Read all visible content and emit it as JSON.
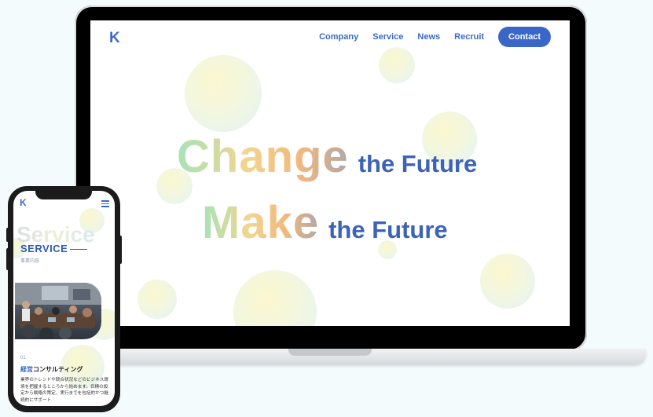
{
  "desktop": {
    "logo": "K",
    "nav": [
      "Company",
      "Service",
      "News",
      "Recruit"
    ],
    "contact_label": "Contact",
    "hero": {
      "line1_big": "Change",
      "line1_small": "the Future",
      "line2_big": "Make",
      "line2_small": "the Future"
    }
  },
  "mobile": {
    "logo": "K",
    "watermark": "Service",
    "section_title": "SERVICE",
    "section_sub": "事業内容",
    "item_number": "01",
    "item_title_accent": "経営",
    "item_title_rest": "コンサルティング",
    "item_body": "業界のトレンドや競合状況などのビジネス環境を把握するところから始めます。目標の設定から戦略の策定、実行までを包括的かつ継続的にサポート"
  },
  "colors": {
    "brand_blue": "#3b6bc8",
    "contact_bg": "#3a66c7",
    "page_bg": "#f4fbfc"
  }
}
